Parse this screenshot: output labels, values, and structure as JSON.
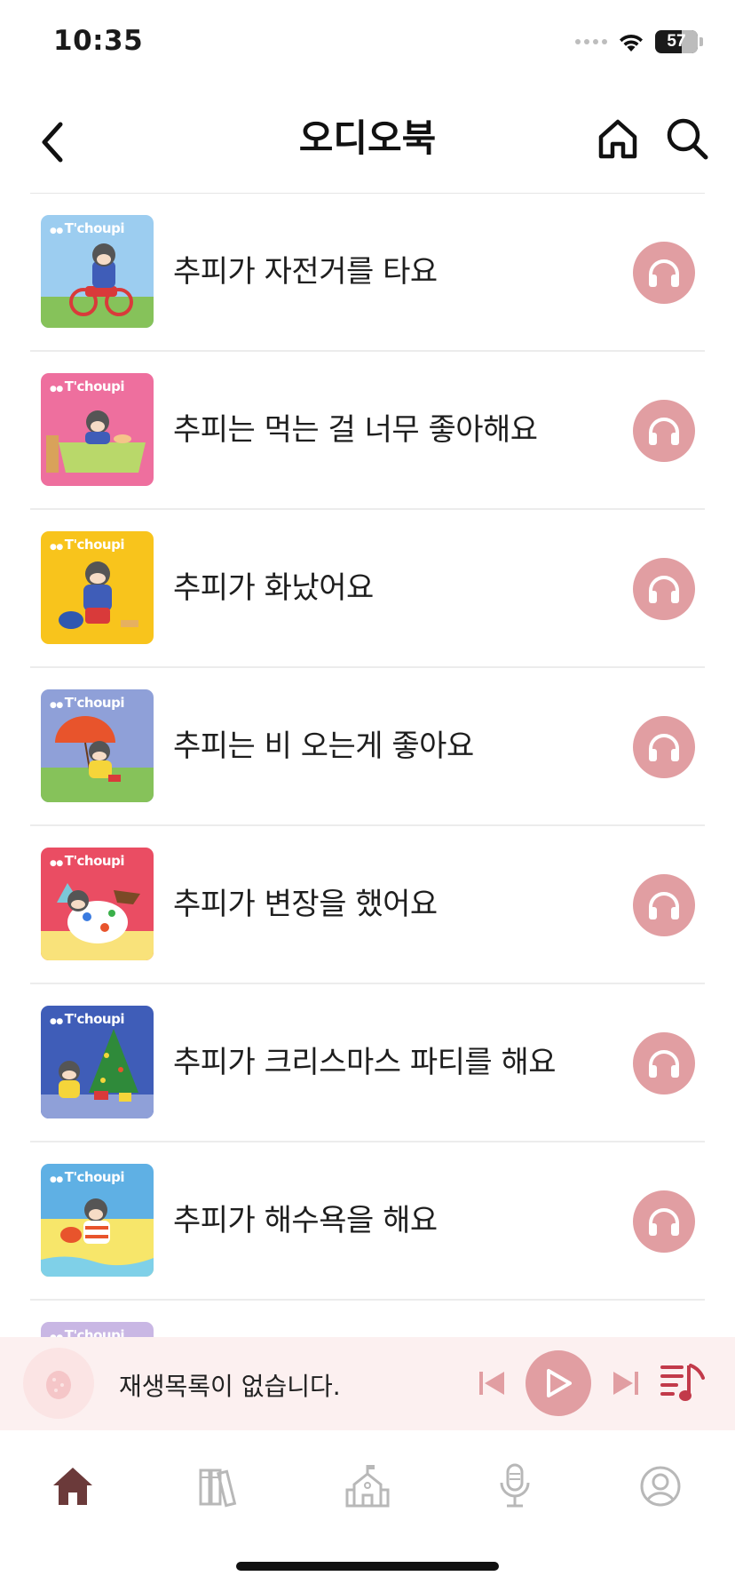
{
  "status_bar": {
    "time": "10:35",
    "battery": "57",
    "icons": [
      "cellular-icon",
      "wifi-icon",
      "battery-icon"
    ]
  },
  "header": {
    "title": "오디오북",
    "icons": [
      "back-icon",
      "home-icon",
      "search-icon"
    ]
  },
  "books": [
    {
      "title": "추피가 자전거를 타요",
      "cover_color": "#9ccdf0"
    },
    {
      "title": "추피는 먹는 걸 너무 좋아해요",
      "cover_color": "#ee6f9e"
    },
    {
      "title": "추피가 화났어요",
      "cover_color": "#f8c41c"
    },
    {
      "title": "추피는 비 오는게 좋아요",
      "cover_color": "#8fa0d8"
    },
    {
      "title": "추피가 변장을 했어요",
      "cover_color": "#ea4d63"
    },
    {
      "title": "추피가 크리스마스 파티를 해요",
      "cover_color": "#3f5db8"
    },
    {
      "title": "추피가 해수욕을 해요",
      "cover_color": "#5fb0e4"
    },
    {
      "title": "",
      "cover_color": "#c9b7e4"
    }
  ],
  "cover_logo": "T'choupi",
  "player": {
    "status": "재생목록이 없습니다.",
    "icons": [
      "previous-icon",
      "play-icon",
      "next-icon",
      "playlist-icon"
    ]
  },
  "tabs": [
    {
      "name": "home",
      "icon": "home-icon",
      "active": true
    },
    {
      "name": "library",
      "icon": "books-icon",
      "active": false
    },
    {
      "name": "school",
      "icon": "school-icon",
      "active": false
    },
    {
      "name": "record",
      "icon": "microphone-icon",
      "active": false
    },
    {
      "name": "profile",
      "icon": "profile-icon",
      "active": false
    }
  ],
  "colors": {
    "accent": "#e19ea2",
    "player_background": "#fcf0f0",
    "active_tab": "#6b3a3a",
    "inactive_tab": "#b8b8b8",
    "playlist_icon": "#c23a4a"
  }
}
